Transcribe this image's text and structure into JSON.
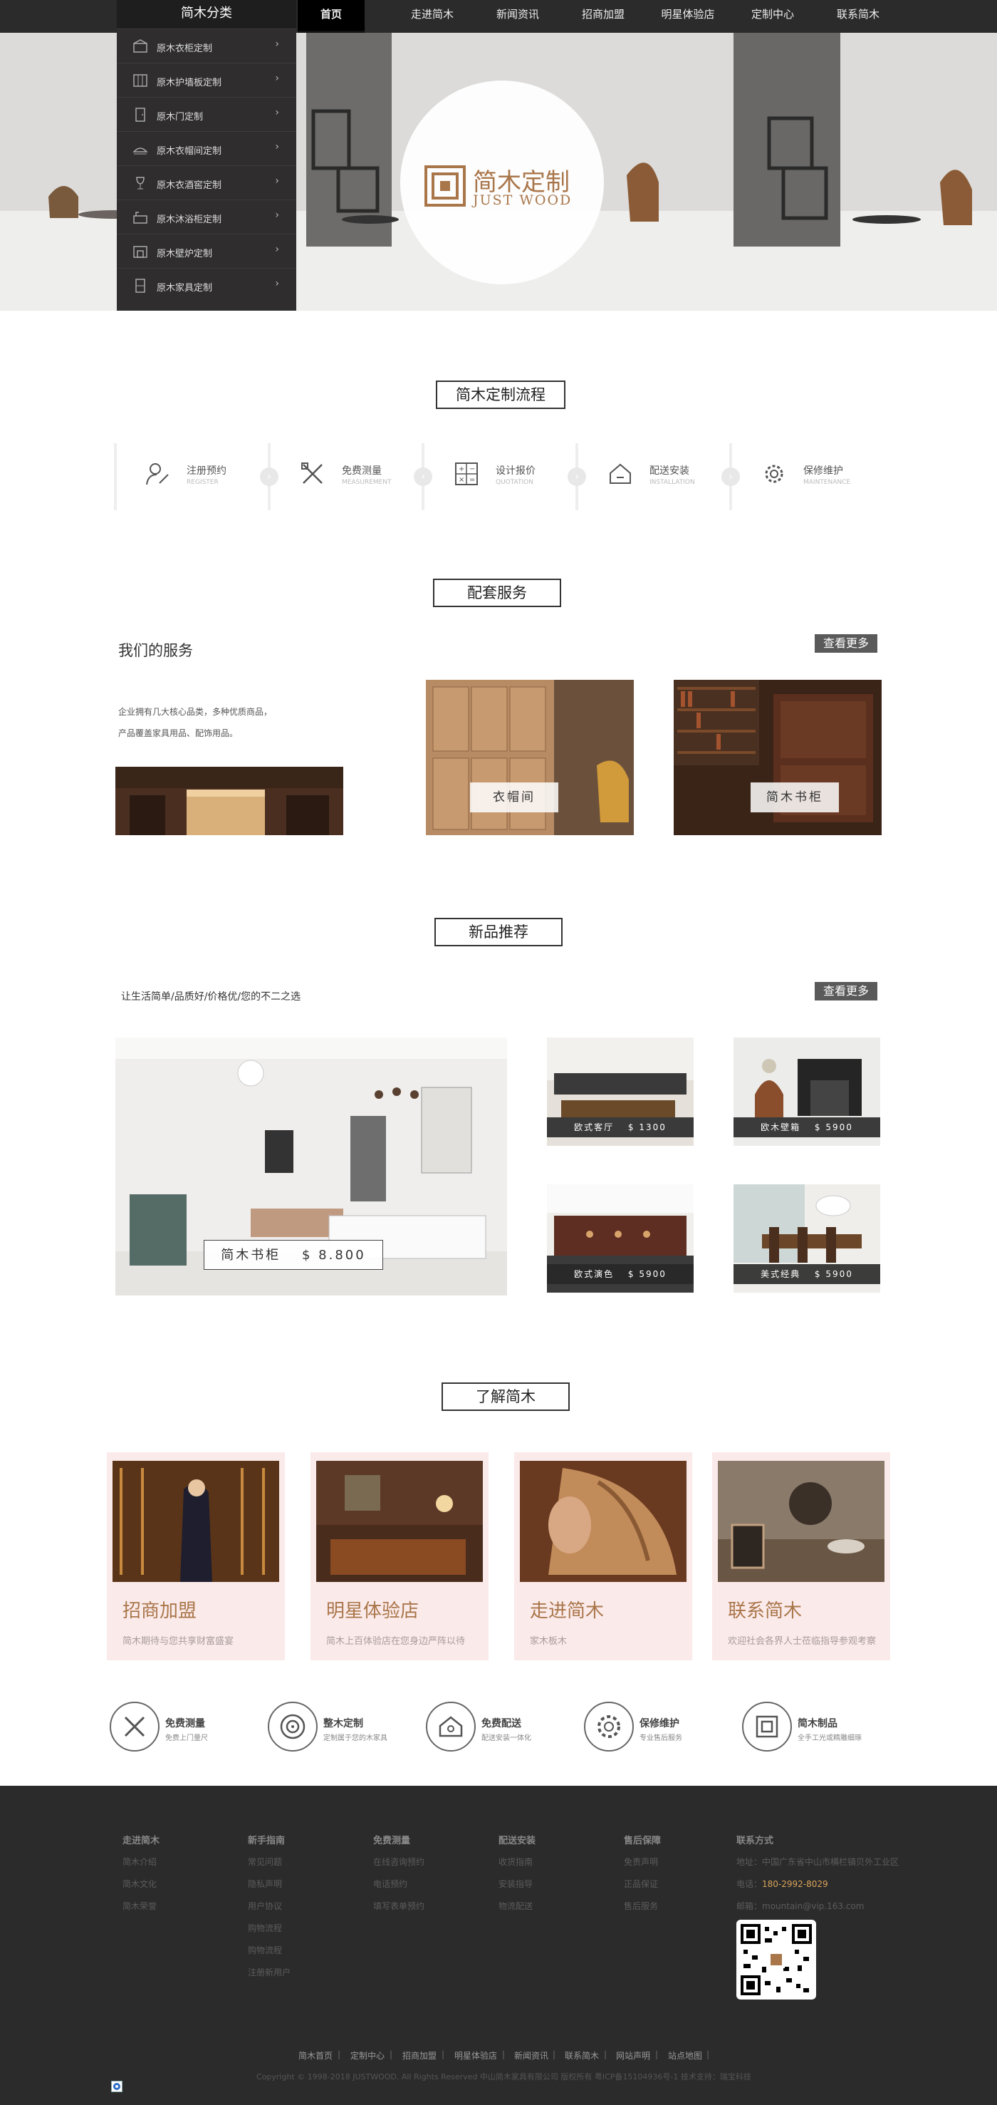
{
  "nav": {
    "items": [
      "首页",
      "走进简木",
      "新闻资讯",
      "招商加盟",
      "明星体验店",
      "定制中心",
      "联系简木"
    ]
  },
  "categories": {
    "title": "简木分类",
    "items": [
      "原木衣柜定制",
      "原木护墙板定制",
      "原木门定制",
      "原木衣帽间定制",
      "原木衣酒窖定制",
      "原木沐浴柜定制",
      "原木壁炉定制",
      "原木家具定制"
    ]
  },
  "hero": {
    "logo_cn": "简木定制",
    "logo_en": "JUST WOOD"
  },
  "process": {
    "title": "简木定制流程",
    "steps": [
      {
        "label": "注册预约",
        "sub": "REGISTER"
      },
      {
        "label": "免费测量",
        "sub": "MEASUREMENT"
      },
      {
        "label": "设计报价",
        "sub": "QUOTATION"
      },
      {
        "label": "配送安装",
        "sub": "INSTALLATION"
      },
      {
        "label": "保修维护",
        "sub": "MAINTENANCE"
      }
    ]
  },
  "services": {
    "title": "配套服务",
    "heading": "我们的服务",
    "more": "查看更多",
    "desc1": "企业拥有几大核心品类，多种优质商品，",
    "desc2": "产品覆盖家具用品、配饰用品。",
    "cards": [
      "衣帽间",
      "简木书柜"
    ]
  },
  "products": {
    "title": "新品推荐",
    "tagline": "让生活简单/品质好/价格优/您的不二之选",
    "more": "查看更多",
    "main_label": "简木书柜　 $ 8.800",
    "items": [
      "欧式客厅　 $ 1300",
      "欧木壁箱　 $ 5900",
      "欧式演色　 $ 5900",
      "美式经典　 $ 5900"
    ]
  },
  "about": {
    "title": "了解简木",
    "cards": [
      {
        "title": "招商加盟",
        "sub": "简木期待与您共享财富盛宴"
      },
      {
        "title": "明星体验店",
        "sub": "简木上百体验店在您身边严阵以待"
      },
      {
        "title": "走进简木",
        "sub": "家木板木"
      },
      {
        "title": "联系简木",
        "sub": "欢迎社会各界人士莅临指导参观考察"
      }
    ]
  },
  "features": [
    {
      "title": "免费测量",
      "sub": "免费上门量尺"
    },
    {
      "title": "整木定制",
      "sub": "定制属于您的木家具"
    },
    {
      "title": "免费配送",
      "sub": "配送安装一体化"
    },
    {
      "title": "保修维护",
      "sub": "专业售后服务"
    },
    {
      "title": "简木制品",
      "sub": "全手工光或精雕细琢"
    }
  ],
  "footer": {
    "cols": [
      {
        "head": "走进简木",
        "links": [
          "简木介绍",
          "简木文化",
          "简木荣誉"
        ]
      },
      {
        "head": "新手指南",
        "links": [
          "常见问题",
          "隐私声明",
          "用户协议",
          "购物流程",
          "购物流程",
          "注册新用户"
        ]
      },
      {
        "head": "免费测量",
        "links": [
          "在线咨询预约",
          "电话预约",
          "填写表单预约"
        ]
      },
      {
        "head": "配送安装",
        "links": [
          "收货指南",
          "安装指导",
          "物流配送"
        ]
      },
      {
        "head": "售后保障",
        "links": [
          "免责声明",
          "正品保证",
          "售后服务"
        ]
      }
    ],
    "contact": {
      "head": "联系方式",
      "address": "地址：中国广东省中山市横栏镇贝外工业区",
      "phone_label": "电话：",
      "phone": "180-2992-8029",
      "email": "邮箱：mountain@vip.163.com"
    },
    "bottom_links": [
      "简木首页",
      "定制中心",
      "招商加盟",
      "明星体验店",
      "新闻资讯",
      "联系简木",
      "网站声明",
      "站点地图"
    ],
    "copyright": "Copyright © 1998-2018 JUSTWOOD. All Rights Reserved 中山简木家具有限公司 版权所有 粤ICP备15104936号-1 技术支持：瑞宝科技"
  },
  "colors": {
    "accent": "#a9764a",
    "nav_bg": "#2b2b2b",
    "footer_bg": "#2b2b2b",
    "phone": "#d9a35b"
  }
}
